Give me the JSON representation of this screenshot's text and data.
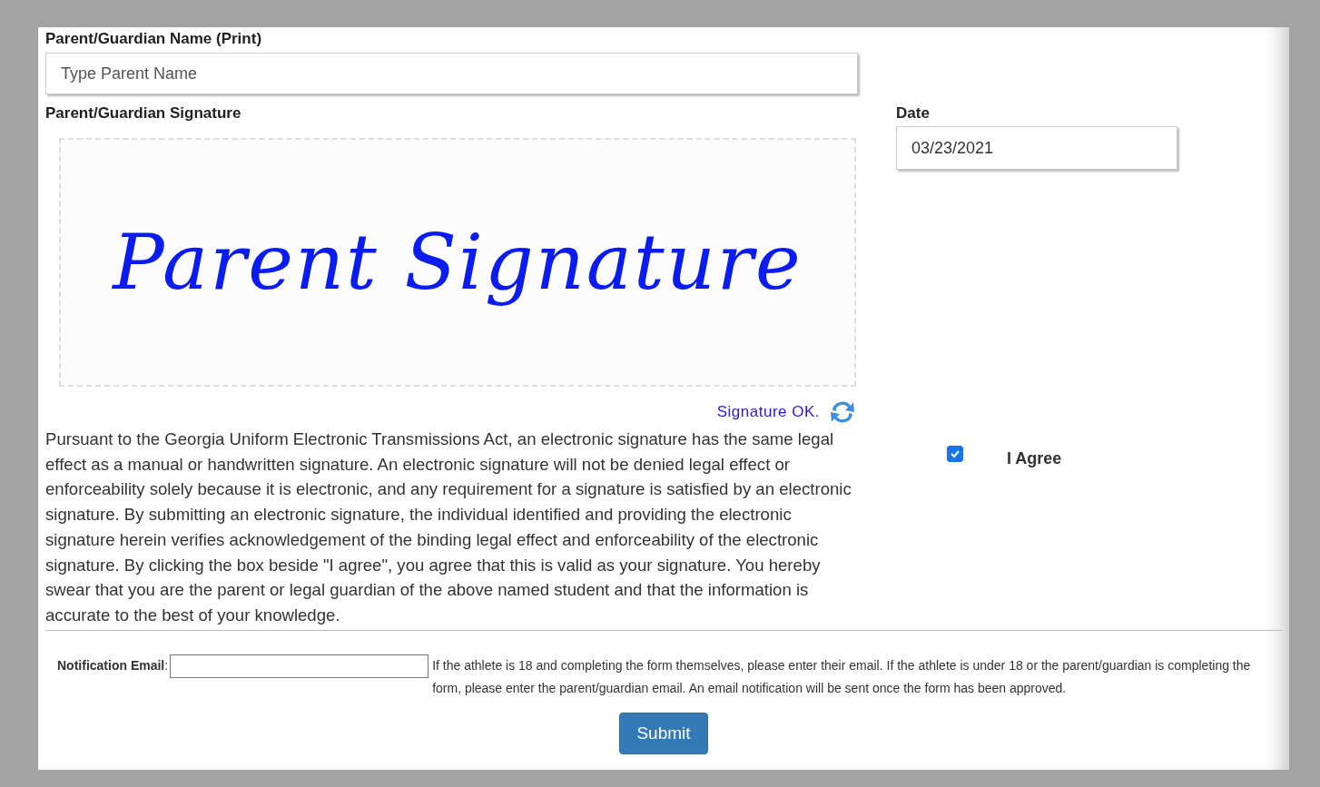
{
  "parent_name": {
    "label": "Parent/Guardian Name (Print)",
    "placeholder": "Type Parent Name"
  },
  "signature": {
    "label": "Parent/Guardian Signature",
    "handwriting": "Parent Signature",
    "status": "Signature OK."
  },
  "date": {
    "label": "Date",
    "value": "03/23/2021"
  },
  "disclaimer": "Pursuant to the Georgia Uniform Electronic Transmissions Act, an electronic signature has the same legal effect as a manual or handwritten signature. An electronic signature will not be denied legal effect or enforceability solely because it is electronic, and any requirement for a signature is satisfied by an electronic signature. By submitting an electronic signature, the individual identified and providing the electronic signature herein verifies acknowledgement of the binding legal effect and enforceability of the electronic signature. By clicking the box beside \"I agree\", you agree that this is valid as your signature. You hereby swear that you are the parent or legal guardian of the above named student and that the information is accurate to the best of your knowledge.",
  "agree": {
    "label": "I Agree",
    "checked": true
  },
  "notification": {
    "label": "**Notification Email**:",
    "note": "If the athlete is 18 and completing the form themselves, please enter their email. If the athlete is under 18 or the parent/guardian is completing the form, please enter the parent/guardian email. An email notification will be sent once the form has been approved."
  },
  "submit": "Submit"
}
